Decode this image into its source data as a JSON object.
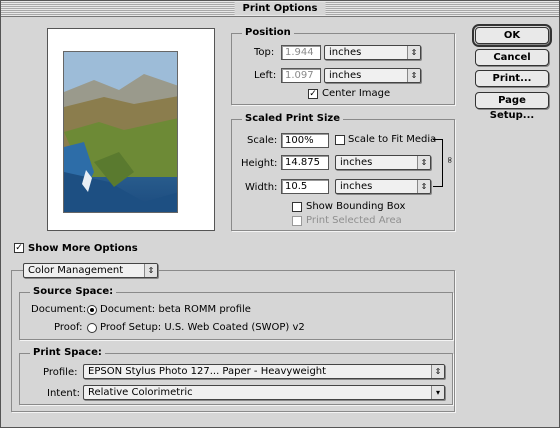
{
  "window": {
    "title": "Print Options"
  },
  "buttons": {
    "ok": "OK",
    "cancel": "Cancel",
    "print": "Print...",
    "page_setup": "Page Setup..."
  },
  "position": {
    "title": "Position",
    "top_label": "Top:",
    "top_value": "1.944",
    "top_unit": "inches",
    "left_label": "Left:",
    "left_value": "1.097",
    "left_unit": "inches",
    "center_label": "Center Image",
    "center_checked": true
  },
  "scaled": {
    "title": "Scaled Print Size",
    "scale_label": "Scale:",
    "scale_value": "100%",
    "fit_label": "Scale to Fit Media",
    "height_label": "Height:",
    "height_value": "14.875",
    "height_unit": "inches",
    "width_label": "Width:",
    "width_value": "10.5",
    "width_unit": "inches",
    "bounding_label": "Show Bounding Box",
    "selected_label": "Print Selected Area"
  },
  "more_options": {
    "label": "Show More Options",
    "checked": true
  },
  "color_mgmt": {
    "popup": "Color Management"
  },
  "source": {
    "title": "Source Space:",
    "document_label": "Document:",
    "document_option": "Document: beta ROMM profile",
    "proof_label": "Proof:",
    "proof_option": "Proof Setup: U.S. Web Coated (SWOP) v2"
  },
  "print_space": {
    "title": "Print Space:",
    "profile_label": "Profile:",
    "profile_value": "EPSON Stylus Photo 127... Paper - Heavyweight",
    "intent_label": "Intent:",
    "intent_value": "Relative Colorimetric"
  },
  "icons": {
    "select_arrows": "⇕",
    "popup_arrow": "▾",
    "check": "✓",
    "link": "∞"
  }
}
